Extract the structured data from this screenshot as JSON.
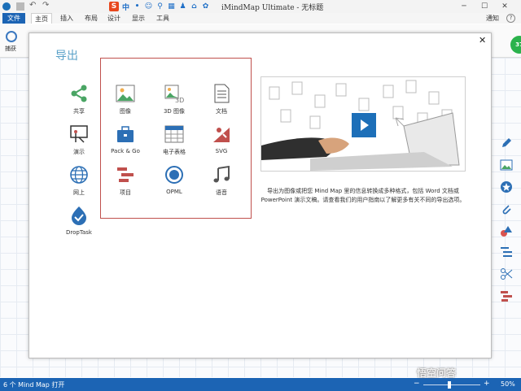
{
  "window": {
    "title": "iMindMap Ultimate - 无标题"
  },
  "ime": {
    "logo": "S",
    "items": [
      "中",
      "•",
      "☺",
      "⚲",
      "▦",
      "♟",
      "⌂",
      "✿"
    ]
  },
  "menu": {
    "file": "文件",
    "home": "主页",
    "insert": "插入",
    "layout": "布局",
    "design": "设计",
    "view": "显示",
    "tools": "工具",
    "notify": "通知"
  },
  "ribbon": {
    "capture": "捕获"
  },
  "badge": "37",
  "dialog": {
    "title": "导出",
    "side": {
      "share": "共享",
      "present": "演示",
      "online": "网上",
      "droptask": "DropTask"
    },
    "formats": {
      "image": "图像",
      "image3d": "3D 图像",
      "document": "文档",
      "packgo": "Pack & Go",
      "spreadsheet": "电子表格",
      "svg": "SVG",
      "project": "项目",
      "opml": "OPML",
      "audio": "语音"
    },
    "description": "导出为图像或把您 Mind Map 里的信息转换成多种格式，包括 Word 文档或 PowerPoint 演示文稿。请查看我们的用户指南以了解更多有关不同的导出选项。"
  },
  "status": {
    "text": "6 个 Mind Map 打开",
    "zoom": "50%",
    "progress": 0.46
  },
  "watermark": "悟空问答",
  "colors": {
    "accent": "#1c64b4",
    "frame": "#c0504d",
    "title": "#5aa1c8"
  }
}
